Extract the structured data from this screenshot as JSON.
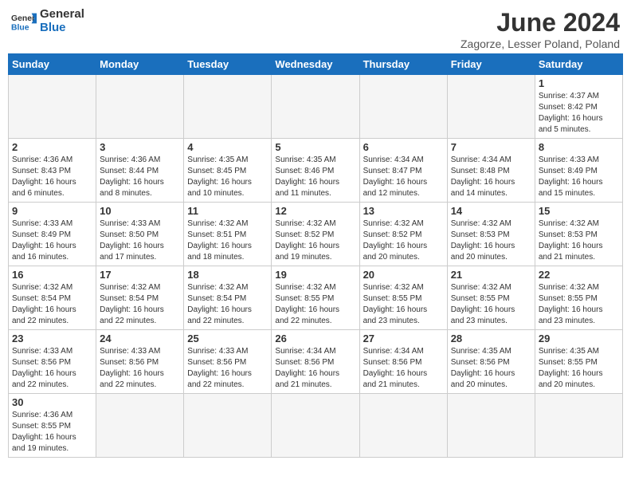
{
  "header": {
    "logo_general": "General",
    "logo_blue": "Blue",
    "month_title": "June 2024",
    "subtitle": "Zagorze, Lesser Poland, Poland"
  },
  "days_of_week": [
    "Sunday",
    "Monday",
    "Tuesday",
    "Wednesday",
    "Thursday",
    "Friday",
    "Saturday"
  ],
  "weeks": [
    [
      {
        "day": "",
        "info": ""
      },
      {
        "day": "",
        "info": ""
      },
      {
        "day": "",
        "info": ""
      },
      {
        "day": "",
        "info": ""
      },
      {
        "day": "",
        "info": ""
      },
      {
        "day": "",
        "info": ""
      },
      {
        "day": "1",
        "info": "Sunrise: 4:37 AM\nSunset: 8:42 PM\nDaylight: 16 hours\nand 5 minutes."
      }
    ],
    [
      {
        "day": "2",
        "info": "Sunrise: 4:36 AM\nSunset: 8:43 PM\nDaylight: 16 hours\nand 6 minutes."
      },
      {
        "day": "3",
        "info": "Sunrise: 4:36 AM\nSunset: 8:44 PM\nDaylight: 16 hours\nand 8 minutes."
      },
      {
        "day": "4",
        "info": "Sunrise: 4:35 AM\nSunset: 8:45 PM\nDaylight: 16 hours\nand 10 minutes."
      },
      {
        "day": "5",
        "info": "Sunrise: 4:35 AM\nSunset: 8:46 PM\nDaylight: 16 hours\nand 11 minutes."
      },
      {
        "day": "6",
        "info": "Sunrise: 4:34 AM\nSunset: 8:47 PM\nDaylight: 16 hours\nand 12 minutes."
      },
      {
        "day": "7",
        "info": "Sunrise: 4:34 AM\nSunset: 8:48 PM\nDaylight: 16 hours\nand 14 minutes."
      },
      {
        "day": "8",
        "info": "Sunrise: 4:33 AM\nSunset: 8:49 PM\nDaylight: 16 hours\nand 15 minutes."
      }
    ],
    [
      {
        "day": "9",
        "info": "Sunrise: 4:33 AM\nSunset: 8:49 PM\nDaylight: 16 hours\nand 16 minutes."
      },
      {
        "day": "10",
        "info": "Sunrise: 4:33 AM\nSunset: 8:50 PM\nDaylight: 16 hours\nand 17 minutes."
      },
      {
        "day": "11",
        "info": "Sunrise: 4:32 AM\nSunset: 8:51 PM\nDaylight: 16 hours\nand 18 minutes."
      },
      {
        "day": "12",
        "info": "Sunrise: 4:32 AM\nSunset: 8:52 PM\nDaylight: 16 hours\nand 19 minutes."
      },
      {
        "day": "13",
        "info": "Sunrise: 4:32 AM\nSunset: 8:52 PM\nDaylight: 16 hours\nand 20 minutes."
      },
      {
        "day": "14",
        "info": "Sunrise: 4:32 AM\nSunset: 8:53 PM\nDaylight: 16 hours\nand 20 minutes."
      },
      {
        "day": "15",
        "info": "Sunrise: 4:32 AM\nSunset: 8:53 PM\nDaylight: 16 hours\nand 21 minutes."
      }
    ],
    [
      {
        "day": "16",
        "info": "Sunrise: 4:32 AM\nSunset: 8:54 PM\nDaylight: 16 hours\nand 22 minutes."
      },
      {
        "day": "17",
        "info": "Sunrise: 4:32 AM\nSunset: 8:54 PM\nDaylight: 16 hours\nand 22 minutes."
      },
      {
        "day": "18",
        "info": "Sunrise: 4:32 AM\nSunset: 8:54 PM\nDaylight: 16 hours\nand 22 minutes."
      },
      {
        "day": "19",
        "info": "Sunrise: 4:32 AM\nSunset: 8:55 PM\nDaylight: 16 hours\nand 22 minutes."
      },
      {
        "day": "20",
        "info": "Sunrise: 4:32 AM\nSunset: 8:55 PM\nDaylight: 16 hours\nand 23 minutes."
      },
      {
        "day": "21",
        "info": "Sunrise: 4:32 AM\nSunset: 8:55 PM\nDaylight: 16 hours\nand 23 minutes."
      },
      {
        "day": "22",
        "info": "Sunrise: 4:32 AM\nSunset: 8:55 PM\nDaylight: 16 hours\nand 23 minutes."
      }
    ],
    [
      {
        "day": "23",
        "info": "Sunrise: 4:33 AM\nSunset: 8:56 PM\nDaylight: 16 hours\nand 22 minutes."
      },
      {
        "day": "24",
        "info": "Sunrise: 4:33 AM\nSunset: 8:56 PM\nDaylight: 16 hours\nand 22 minutes."
      },
      {
        "day": "25",
        "info": "Sunrise: 4:33 AM\nSunset: 8:56 PM\nDaylight: 16 hours\nand 22 minutes."
      },
      {
        "day": "26",
        "info": "Sunrise: 4:34 AM\nSunset: 8:56 PM\nDaylight: 16 hours\nand 21 minutes."
      },
      {
        "day": "27",
        "info": "Sunrise: 4:34 AM\nSunset: 8:56 PM\nDaylight: 16 hours\nand 21 minutes."
      },
      {
        "day": "28",
        "info": "Sunrise: 4:35 AM\nSunset: 8:56 PM\nDaylight: 16 hours\nand 20 minutes."
      },
      {
        "day": "29",
        "info": "Sunrise: 4:35 AM\nSunset: 8:55 PM\nDaylight: 16 hours\nand 20 minutes."
      }
    ],
    [
      {
        "day": "30",
        "info": "Sunrise: 4:36 AM\nSunset: 8:55 PM\nDaylight: 16 hours\nand 19 minutes."
      },
      {
        "day": "",
        "info": ""
      },
      {
        "day": "",
        "info": ""
      },
      {
        "day": "",
        "info": ""
      },
      {
        "day": "",
        "info": ""
      },
      {
        "day": "",
        "info": ""
      },
      {
        "day": "",
        "info": ""
      }
    ]
  ]
}
